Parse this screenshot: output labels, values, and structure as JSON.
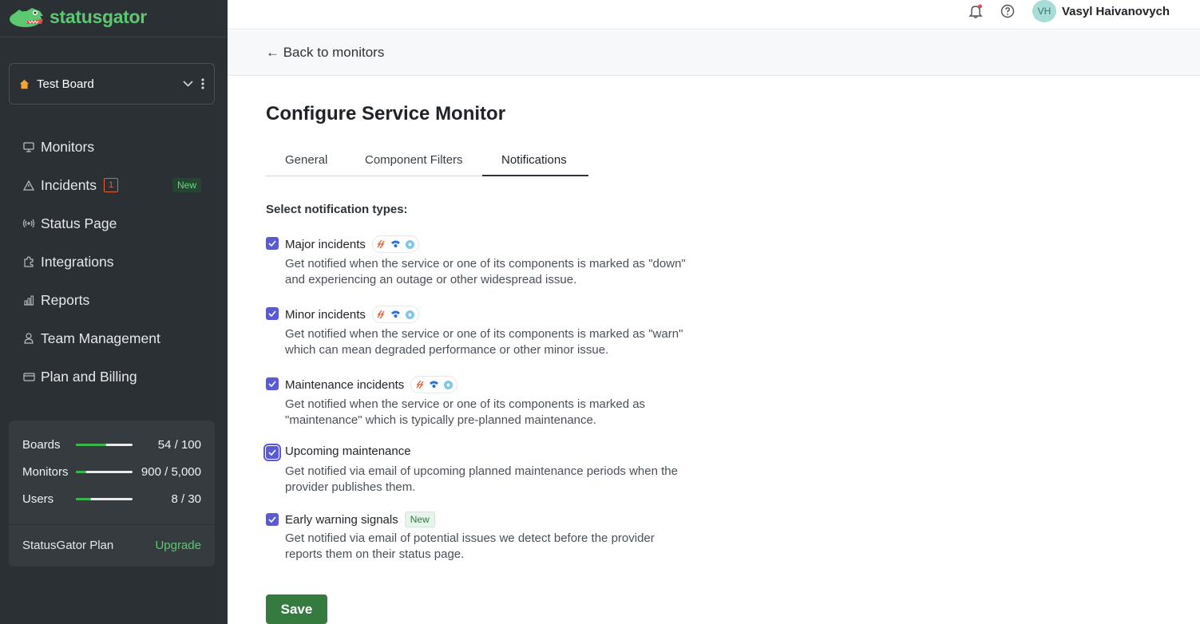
{
  "brand": {
    "name": "statusgator"
  },
  "board": {
    "name": "Test Board"
  },
  "nav": {
    "items": [
      {
        "label": "Monitors",
        "icon": "monitor-icon"
      },
      {
        "label": "Incidents",
        "icon": "warning-icon",
        "count": "1",
        "badge": "New"
      },
      {
        "label": "Status Page",
        "icon": "broadcast-icon"
      },
      {
        "label": "Integrations",
        "icon": "puzzle-icon"
      },
      {
        "label": "Reports",
        "icon": "bar-chart-icon"
      },
      {
        "label": "Team Management",
        "icon": "user-icon"
      },
      {
        "label": "Plan and Billing",
        "icon": "credit-card-icon"
      }
    ]
  },
  "usage": {
    "boards": {
      "label": "Boards",
      "value": "54 / 100",
      "fraction": 0.54
    },
    "monitors": {
      "label": "Monitors",
      "value": "900 / 5,000",
      "fraction": 0.18
    },
    "users": {
      "label": "Users",
      "value": "8 / 30",
      "fraction": 0.27
    }
  },
  "plan": {
    "label": "StatusGator Plan",
    "upgrade": "Upgrade"
  },
  "user": {
    "initials": "VH",
    "name": "Vasyl Haivanovych"
  },
  "back": {
    "label": "← Back to monitors"
  },
  "page": {
    "title": "Configure Service Monitor"
  },
  "tabs": [
    {
      "label": "General"
    },
    {
      "label": "Component Filters"
    },
    {
      "label": "Notifications",
      "active": true
    }
  ],
  "notifications": {
    "heading": "Select notification types:",
    "options": [
      {
        "title": "Major incidents",
        "desc": "Get notified when the service or one of its components is marked as \"down\" and experiencing an outage or other widespread issue.",
        "checked": true,
        "icons": true
      },
      {
        "title": "Minor incidents",
        "desc": "Get notified when the service or one of its components is marked as \"warn\" which can mean degraded performance or other minor issue.",
        "checked": true,
        "icons": true
      },
      {
        "title": "Maintenance incidents",
        "desc": "Get notified when the service or one of its components is marked as \"maintenance\" which is typically pre-planned maintenance.",
        "checked": true,
        "icons": true
      },
      {
        "title": "Upcoming maintenance",
        "desc": "Get notified via email of upcoming planned maintenance periods when the provider publishes them.",
        "checked": true
      },
      {
        "title": "Early warning signals",
        "badge": "New",
        "desc": "Get notified via email of potential issues we detect before the provider reports them on their status page.",
        "checked": true
      }
    ]
  },
  "actions": {
    "save": "Save"
  },
  "colors": {
    "sidebar": "#2b3034",
    "brand_green": "#5cc870",
    "checkbox": "#5a5bd4",
    "save": "#357a3f"
  }
}
